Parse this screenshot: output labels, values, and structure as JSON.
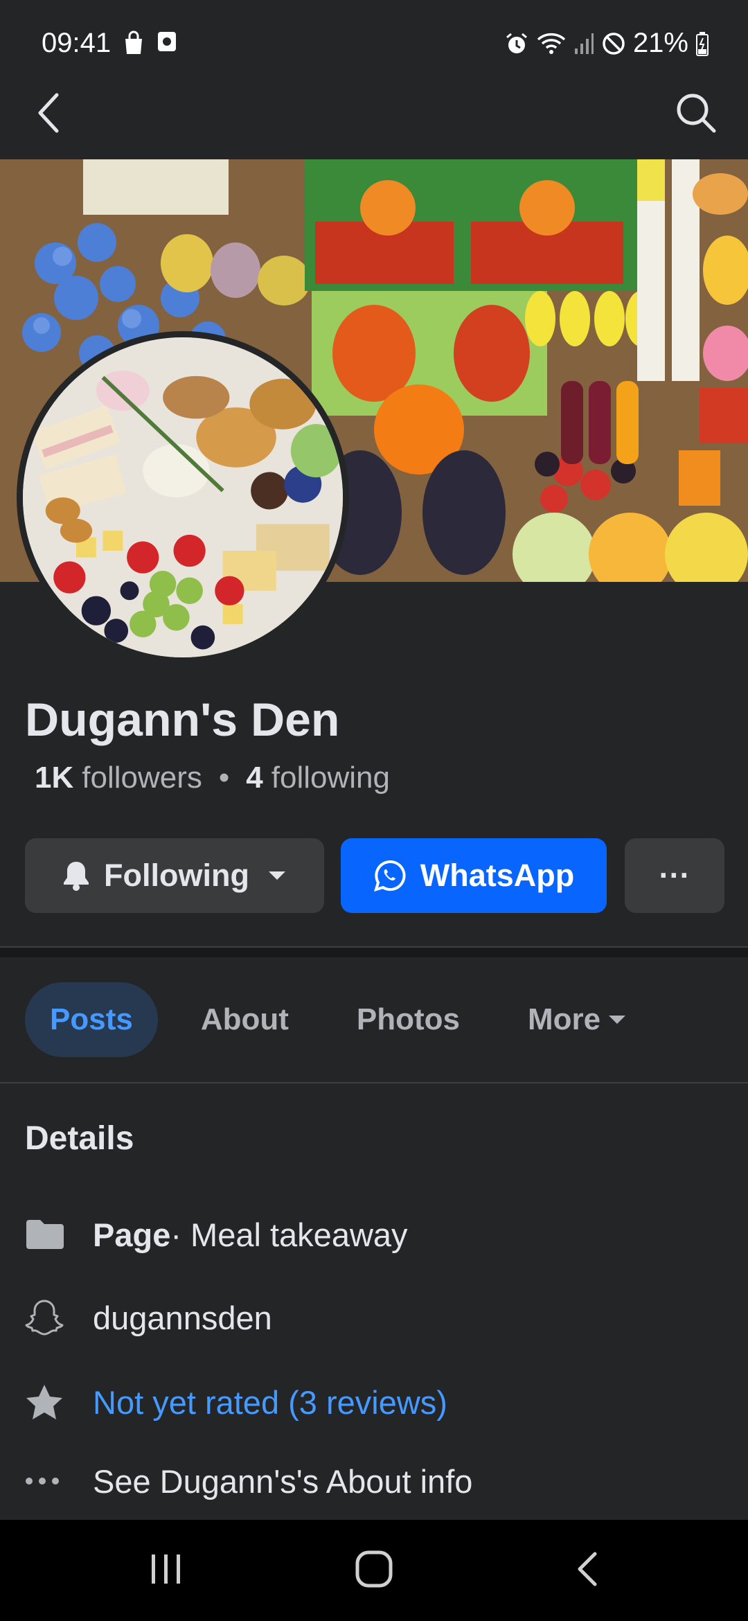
{
  "status_bar": {
    "time": "09:41",
    "battery": "21%",
    "icons_left": [
      "shopping-bag-icon",
      "screen-record-icon"
    ],
    "icons_right": [
      "alarm-icon",
      "wifi-icon",
      "signal-icon",
      "dnd-icon",
      "battery-icon"
    ]
  },
  "nav": {
    "back_icon": "back-arrow-icon",
    "search_icon": "search-icon"
  },
  "profile": {
    "name": "Dugann's Den",
    "followers_count": "1K",
    "followers_label": "followers",
    "following_count": "4",
    "following_label": "following",
    "separator": "•"
  },
  "actions": {
    "following_label": "Following",
    "whatsapp_label": "WhatsApp",
    "more_label": "···"
  },
  "tabs": {
    "posts": "Posts",
    "about": "About",
    "photos": "Photos",
    "more": "More"
  },
  "details": {
    "title": "Details",
    "page_label": "Page",
    "page_category": " · Meal takeaway",
    "snapchat": "dugannsden",
    "rating": "Not yet rated (3 reviews)",
    "about_info": "See Dugann's's About info"
  },
  "colors": {
    "background": "#242526",
    "accent_blue": "#0866ff",
    "link_blue": "#4599ff",
    "tab_active_bg": "#263951"
  }
}
